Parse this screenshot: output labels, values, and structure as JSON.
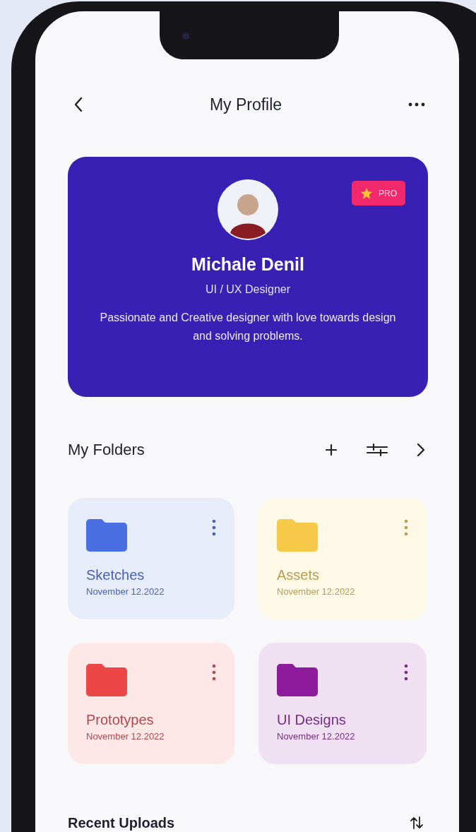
{
  "header": {
    "title": "My Profile"
  },
  "profile": {
    "badge": "PRO",
    "name": "Michale Denil",
    "role": "UI / UX Designer",
    "bio": "Passionate and Creative designer with love towards design and solving problems."
  },
  "folders_section": {
    "title": "My Folders"
  },
  "folders": [
    {
      "name": "Sketches",
      "date": "November 12.2022",
      "color": "#4a6fe3"
    },
    {
      "name": "Assets",
      "date": "November 12.2022",
      "color": "#f7c948"
    },
    {
      "name": "Prototypes",
      "date": "November 12.2022",
      "color": "#ec4646"
    },
    {
      "name": "UI Designs",
      "date": "November 12.2022",
      "color": "#8e1a9c"
    }
  ],
  "recent_section": {
    "title": "Recent Uploads"
  }
}
